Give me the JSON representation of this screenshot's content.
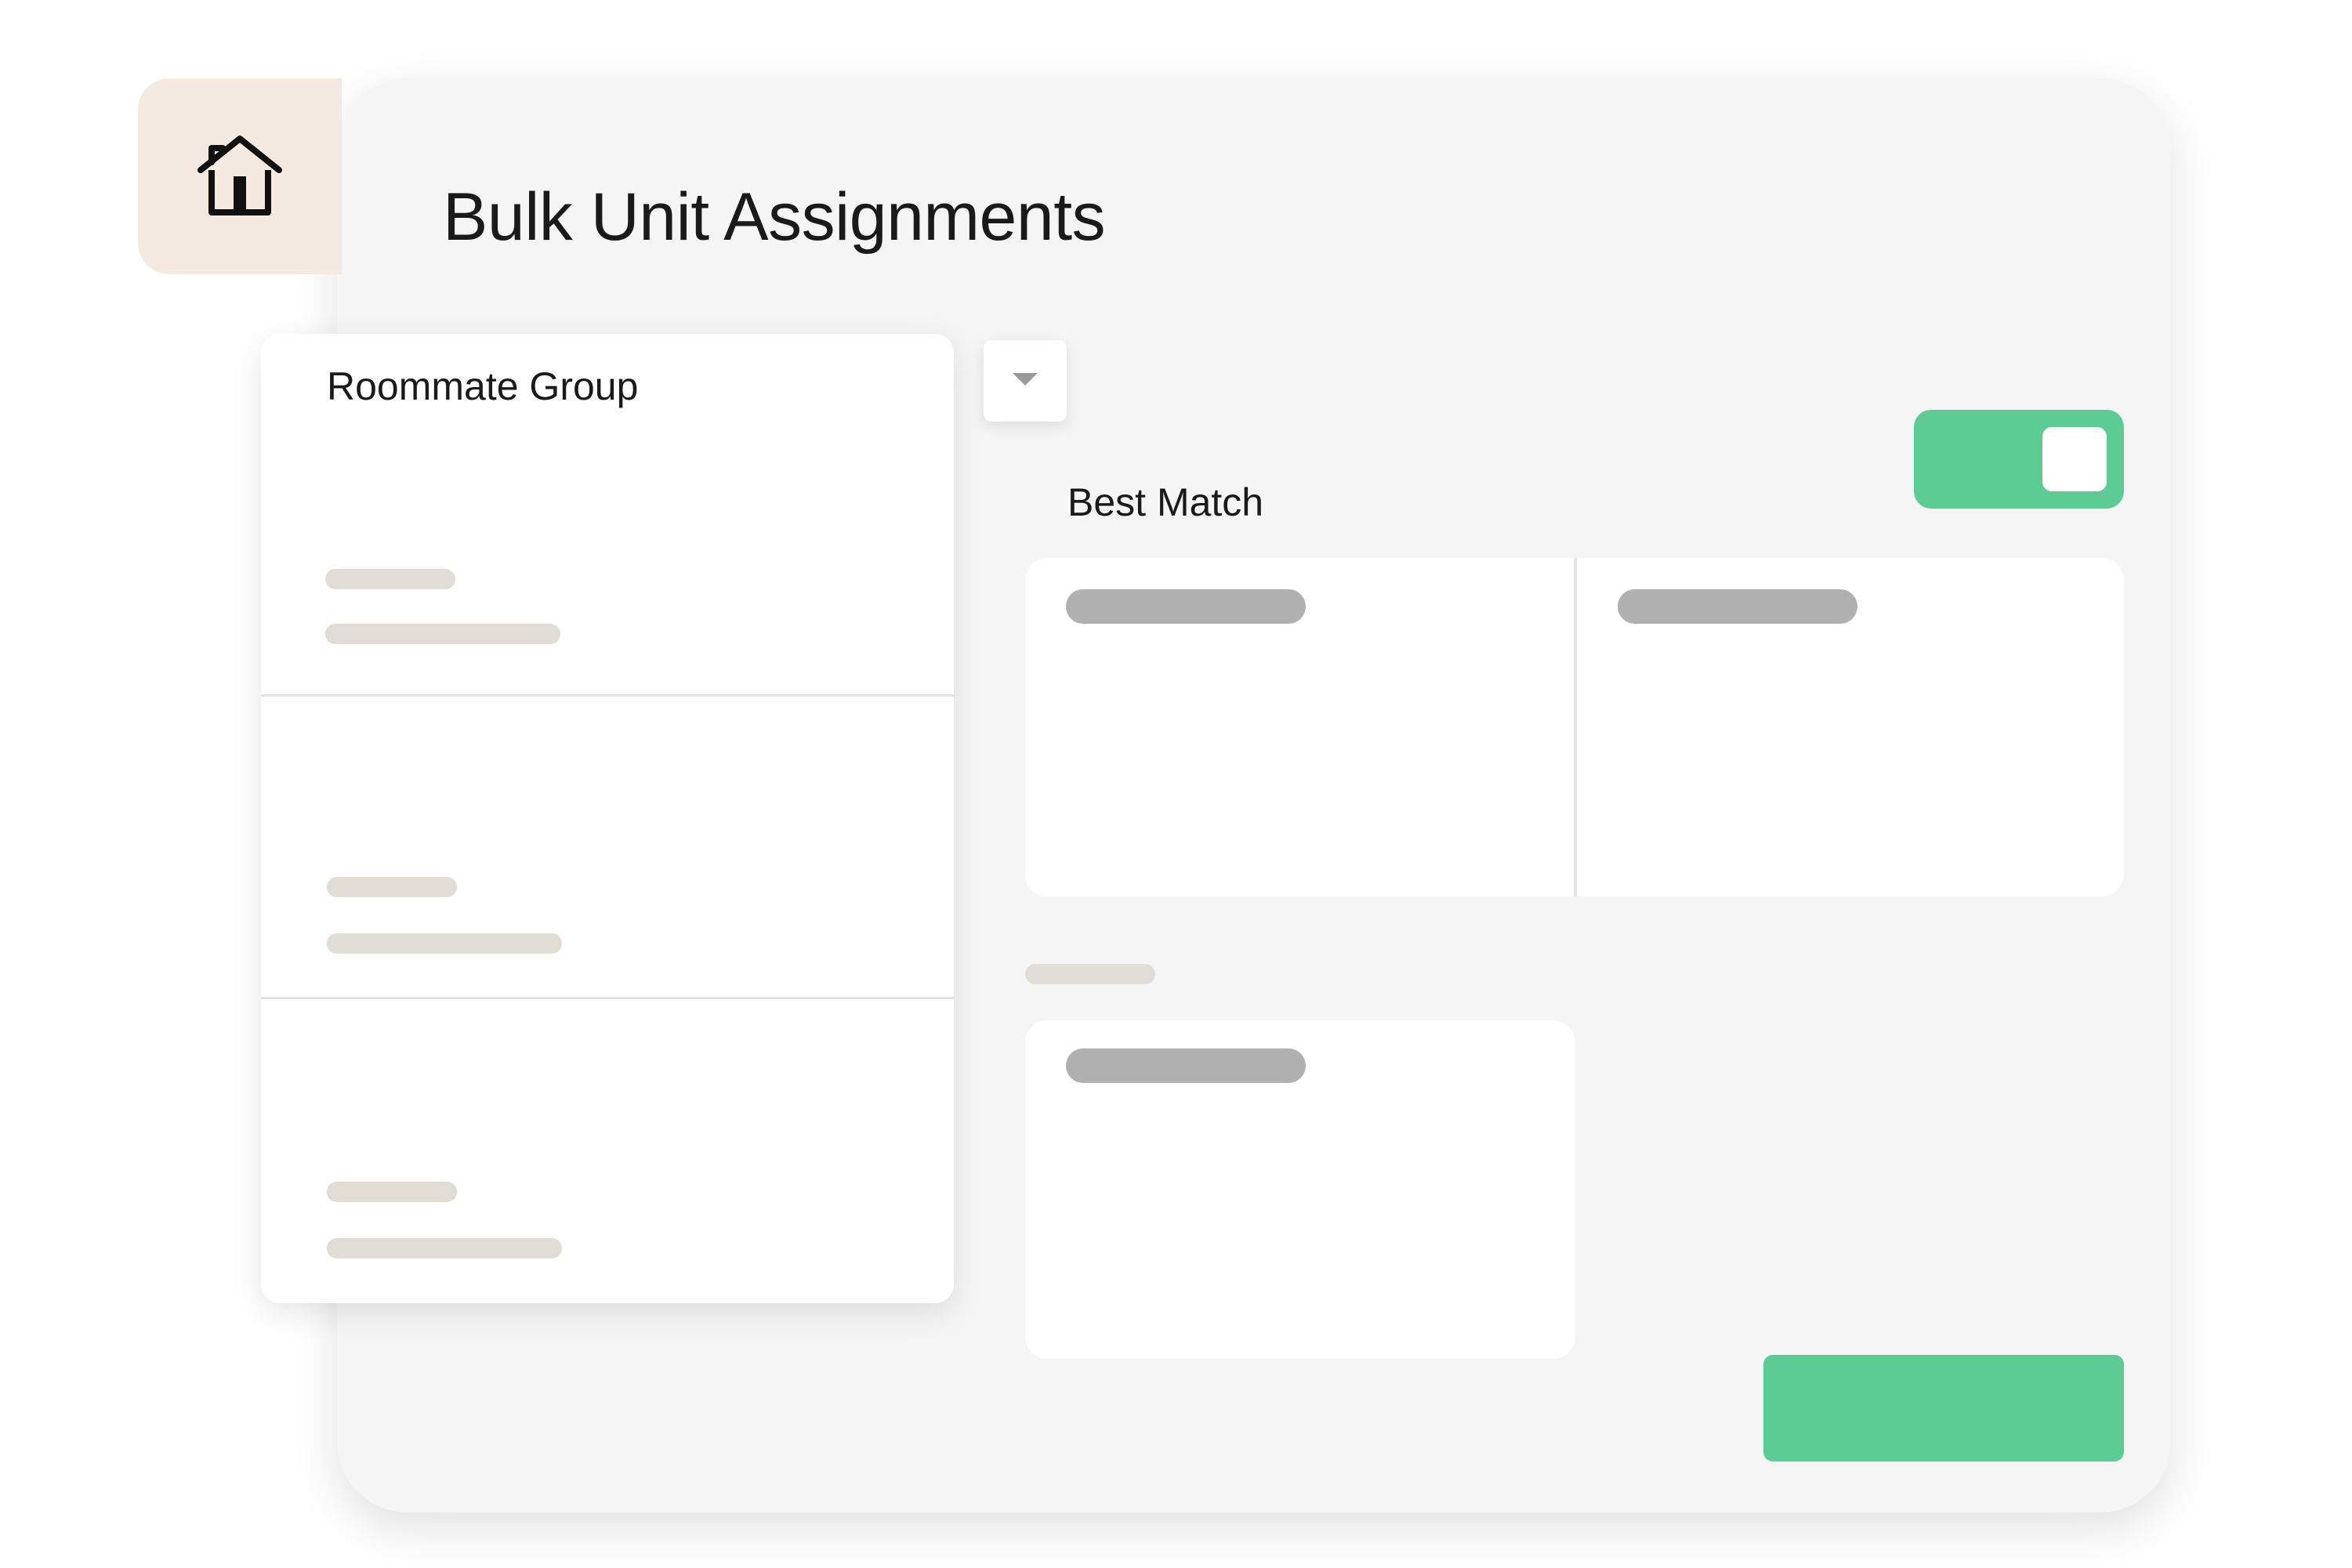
{
  "header": {
    "title": "Bulk Unit Assignments",
    "home_icon": "home-icon"
  },
  "roommate_group": {
    "title": "Roommate Group",
    "rows": [
      {
        "placeholder": "placeholder-line"
      },
      {
        "placeholder": "placeholder-line"
      },
      {
        "placeholder": "placeholder-line"
      }
    ]
  },
  "dropdown": {
    "icon": "chevron-down-icon"
  },
  "best_match": {
    "label": "Best Match",
    "toggle_on": true
  },
  "colors": {
    "accent": "#5ccc94",
    "home_tile": "#f4eae2",
    "panel_bg": "#f5f5f5",
    "placeholder_light": "#e1ddd5",
    "placeholder_dark": "#b0b0b0"
  }
}
